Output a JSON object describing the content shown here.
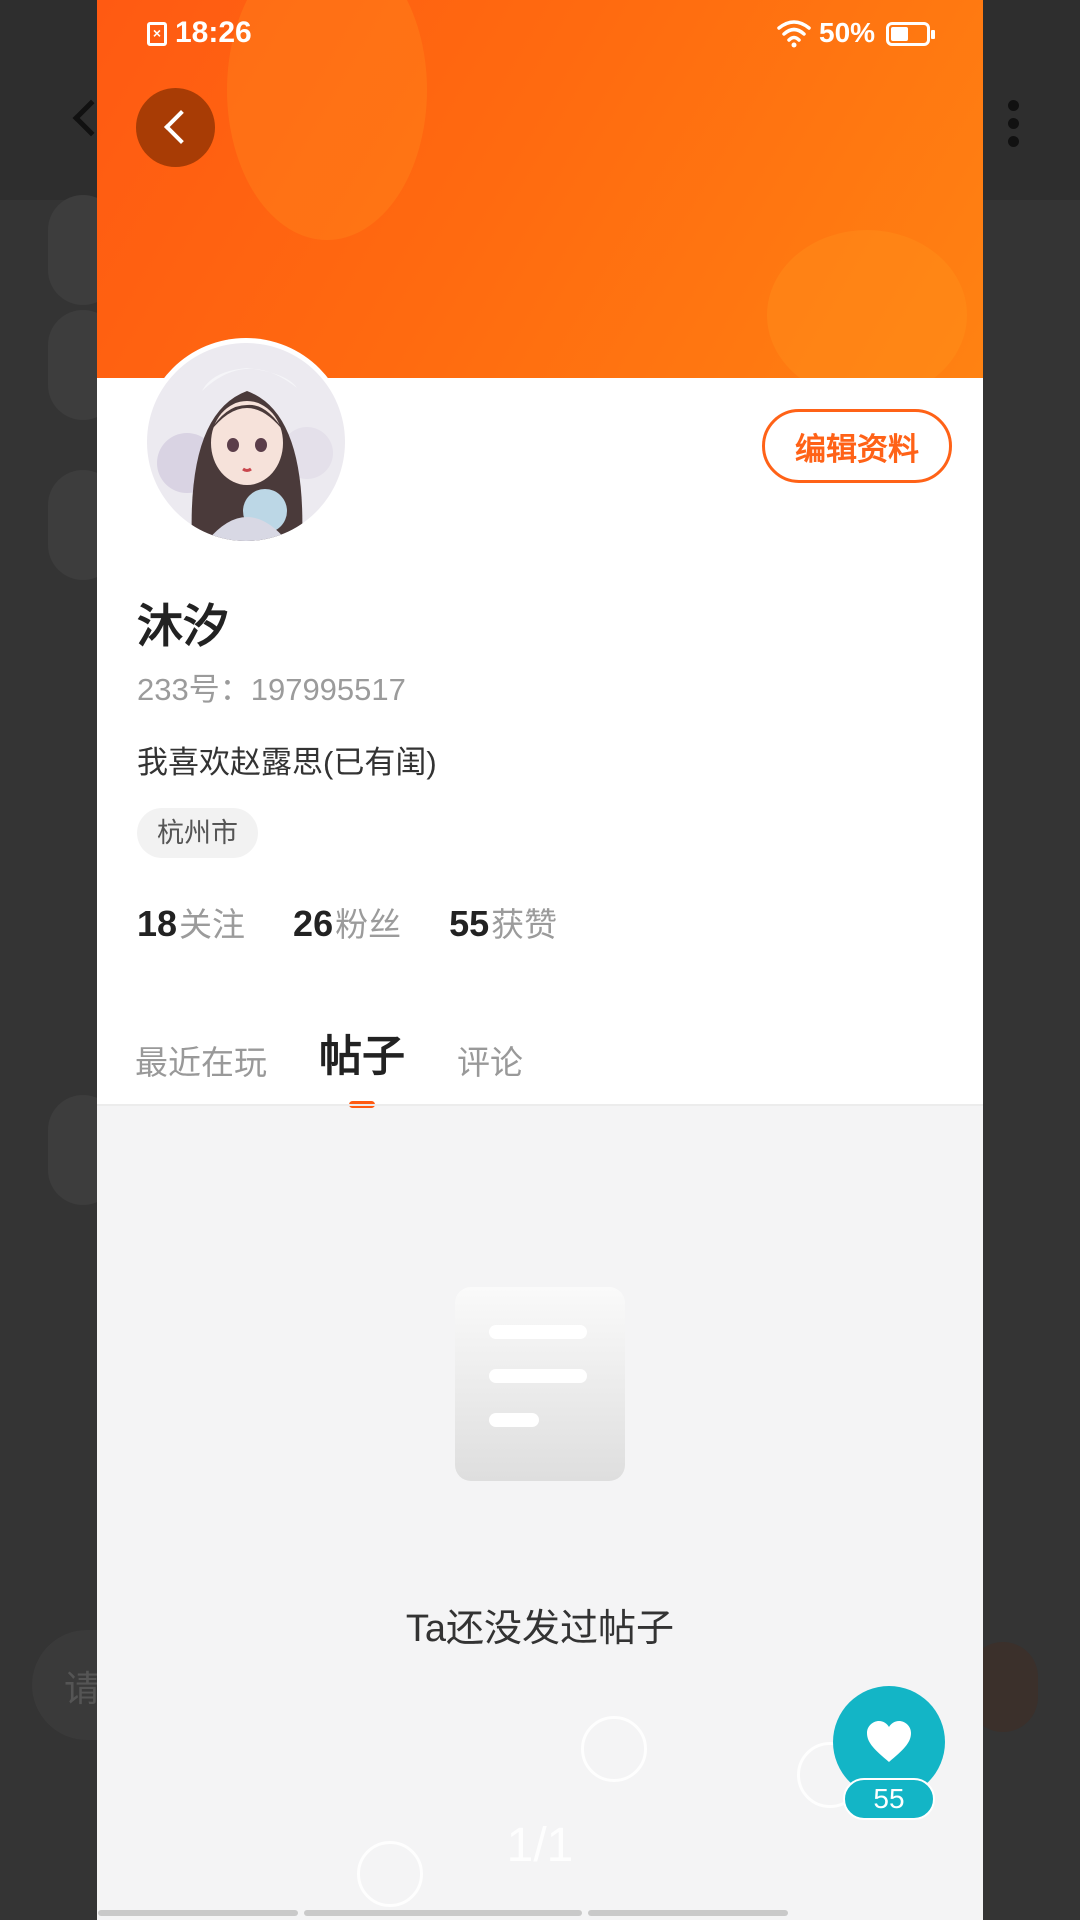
{
  "status_bar": {
    "time": "18:26",
    "battery": "50%"
  },
  "profile": {
    "name": "沐汐",
    "uid": "233号：197995517",
    "bio": "我喜欢赵露思(已有闺)",
    "location": "杭州市",
    "edit_button": "编辑资料"
  },
  "stats": [
    {
      "value": "18",
      "label": "关注"
    },
    {
      "value": "26",
      "label": "粉丝"
    },
    {
      "value": "55",
      "label": "获赞"
    }
  ],
  "tabs": [
    {
      "label": "最近在玩"
    },
    {
      "label": "帖子",
      "active": true
    },
    {
      "label": "评论"
    }
  ],
  "empty_state": {
    "text": "Ta还没发过帖子"
  },
  "page_indicator": "1/1",
  "like": {
    "count": "55"
  },
  "colors": {
    "accent": "#ff5a12",
    "like": "#13b5c6"
  }
}
